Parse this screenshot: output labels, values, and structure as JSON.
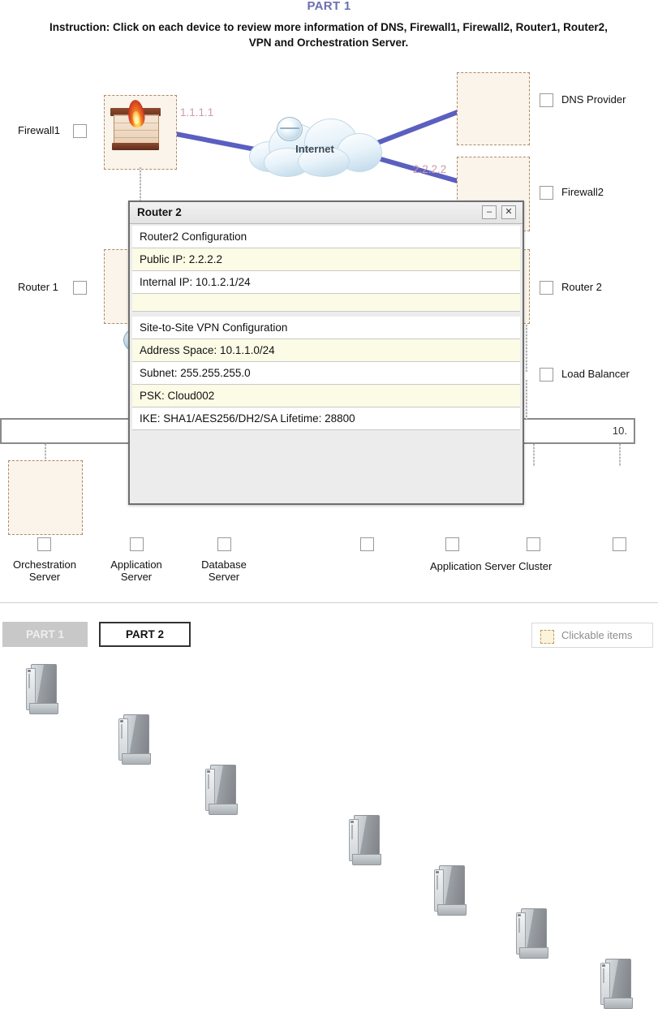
{
  "header": {
    "part_title": "PART 1",
    "instruction": "Instruction: Click on each device to review more information of DNS, Firewall1, Firewall2, Router1, Router2, VPN and Orchestration Server."
  },
  "diagram": {
    "cloud_label": "Internet",
    "ip_tags": [
      {
        "name": "firewall1-ip",
        "value": "1.1.1.1"
      },
      {
        "name": "firewall2-ip",
        "value": "2.2.2.2"
      }
    ],
    "subnet_bar_label": "10.",
    "devices": [
      {
        "id": "firewall1",
        "label": "Firewall1"
      },
      {
        "id": "router1",
        "label": "Router 1"
      },
      {
        "id": "dns-provider",
        "label": "DNS Provider"
      },
      {
        "id": "firewall2",
        "label": "Firewall2"
      },
      {
        "id": "router2",
        "label": "Router 2"
      },
      {
        "id": "load-balancer",
        "label": "Load Balancer"
      }
    ],
    "bottom_devices": [
      {
        "id": "orchestration-server",
        "line1": "Orchestration",
        "line2": "Server"
      },
      {
        "id": "application-server",
        "line1": "Application",
        "line2": "Server"
      },
      {
        "id": "database-server",
        "line1": "Database",
        "line2": "Server"
      }
    ],
    "cluster_label": "Application Server Cluster",
    "cluster_checkbox_count": 4,
    "colors": {
      "ip_tag": "#d09aa4",
      "wan_link": "#5a5fc0",
      "clickable_border": "#b08a6a",
      "clickable_fill": "#faf4ea",
      "title": "#6a6fb0"
    }
  },
  "dialog": {
    "title": "Router 2",
    "minimize_label": "–",
    "close_label": "✕",
    "rows": [
      {
        "text": "Router2 Configuration",
        "alt": false
      },
      {
        "text": "Public IP: 2.2.2.2",
        "alt": true
      },
      {
        "text": "Internal IP: 10.1.2.1/24",
        "alt": false
      },
      {
        "text": "",
        "alt": true
      },
      {
        "text": "Site-to-Site VPN Configuration",
        "alt": false
      },
      {
        "text": "Address Space: 10.1.1.0/24",
        "alt": true
      },
      {
        "text": "Subnet: 255.255.255.0",
        "alt": false
      },
      {
        "text": "PSK: Cloud002",
        "alt": true
      },
      {
        "text": "IKE: SHA1/AES256/DH2/SA Lifetime: 28800",
        "alt": false
      }
    ]
  },
  "footer": {
    "part1_label": "PART 1",
    "part2_label": "PART 2",
    "legend_label": "Clickable items"
  }
}
